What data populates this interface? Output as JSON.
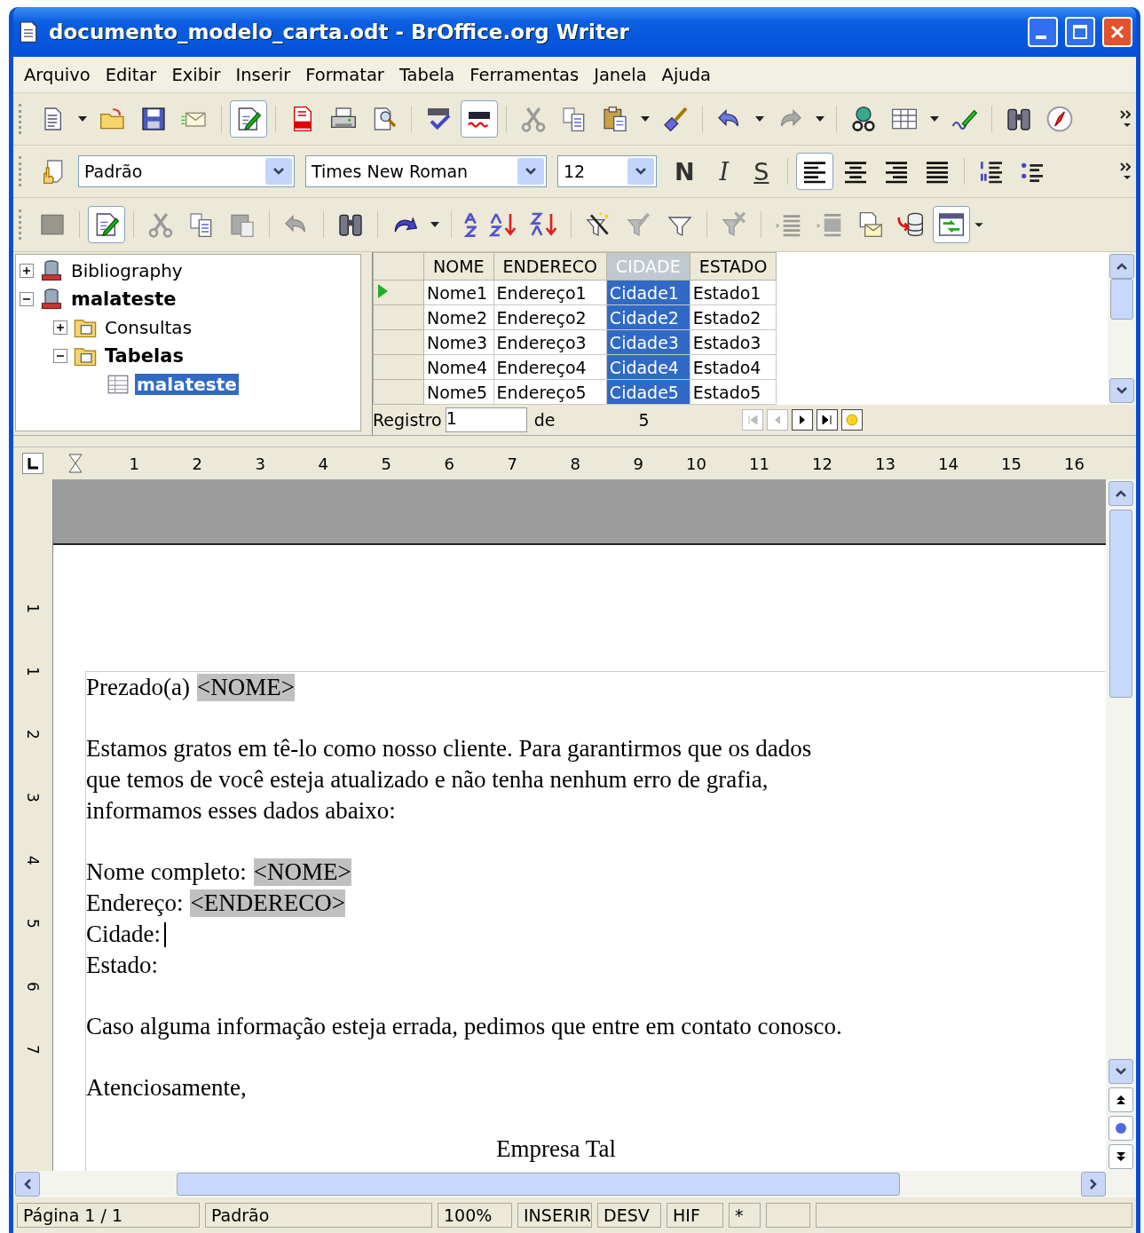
{
  "window": {
    "title": "documento_modelo_carta.odt - BrOffice.org Writer"
  },
  "menu": [
    "Arquivo",
    "Editar",
    "Exibir",
    "Inserir",
    "Formatar",
    "Tabela",
    "Ferramentas",
    "Janela",
    "Ajuda"
  ],
  "standard_toolbar": {
    "edit_mode_on": true,
    "auto_spellcheck_on": true
  },
  "formatting_toolbar": {
    "style": "Padrão",
    "font": "Times New Roman",
    "size": "12",
    "style_buttons": [
      {
        "label": "N"
      },
      {
        "label": "I"
      },
      {
        "label": "S"
      }
    ],
    "align_left_on": true
  },
  "datasource_toolbar": {
    "edit_data_on": true,
    "explorer_on": true
  },
  "datasource_tree": [
    {
      "label": "Bibliography",
      "expanded": false
    },
    {
      "label": "malateste",
      "expanded": true,
      "children": [
        {
          "label": "Consultas",
          "expanded": false
        },
        {
          "label": "Tabelas",
          "expanded": true,
          "children": [
            {
              "label": "malateste",
              "selected": true
            }
          ]
        }
      ]
    }
  ],
  "data_grid": {
    "columns": [
      {
        "label": "NOME",
        "selected": false
      },
      {
        "label": "ENDERECO",
        "selected": false
      },
      {
        "label": "CIDADE",
        "selected": true
      },
      {
        "label": "ESTADO",
        "selected": false
      }
    ],
    "rows": [
      {
        "current": true,
        "cells": [
          "Nome1",
          "Endereço1",
          "Cidade1",
          "Estado1"
        ]
      },
      {
        "current": false,
        "cells": [
          "Nome2",
          "Endereço2",
          "Cidade2",
          "Estado2"
        ]
      },
      {
        "current": false,
        "cells": [
          "Nome3",
          "Endereço3",
          "Cidade3",
          "Estado3"
        ]
      },
      {
        "current": false,
        "cells": [
          "Nome4",
          "Endereço4",
          "Cidade4",
          "Estado4"
        ]
      },
      {
        "current": false,
        "cells": [
          "Nome5",
          "Endereço5",
          "Cidade5",
          "Estado5"
        ]
      }
    ],
    "navigation": {
      "label": "Registro",
      "record": "1",
      "of": "de",
      "total": "5"
    }
  },
  "ruler": {
    "horizontal": [
      "1",
      "2",
      "3",
      "4",
      "5",
      "6",
      "7",
      "8",
      "9",
      "10",
      "11",
      "12",
      "13",
      "14",
      "15",
      "16"
    ],
    "vertical": [
      "1",
      "1",
      "2",
      "3",
      "4",
      "5",
      "6",
      "7"
    ]
  },
  "document": {
    "paragraphs": [
      {
        "kind": "body",
        "lines": [
          [
            {
              "kind": "text",
              "text": "Prezado(a)"
            },
            {
              "kind": "field",
              "text": "<NOME>"
            }
          ]
        ]
      },
      {
        "kind": "body",
        "lines": [
          [
            {
              "kind": "text",
              "text": "Estamos gratos em tê-lo como nosso cliente. Para garantirmos que os dados"
            }
          ],
          [
            {
              "kind": "text",
              "text": "que temos de você esteja atualizado e não tenha nenhum erro de grafia,"
            }
          ],
          [
            {
              "kind": "text",
              "text": "informamos esses dados abaixo:"
            }
          ]
        ]
      },
      {
        "kind": "body",
        "lines": [
          [
            {
              "kind": "text",
              "text": "Nome completo:"
            },
            {
              "kind": "field",
              "text": "<NOME>"
            }
          ],
          [
            {
              "kind": "text",
              "text": "Endereço:"
            },
            {
              "kind": "field",
              "text": "<ENDERECO>"
            }
          ],
          [
            {
              "kind": "text",
              "text": "Cidade:"
            },
            {
              "kind": "cursor"
            }
          ],
          [
            {
              "kind": "text",
              "text": "Estado:"
            }
          ]
        ]
      },
      {
        "kind": "body",
        "lines": [
          [
            {
              "kind": "text",
              "text": "Caso alguma informação esteja errada, pedimos que entre em contato conosco."
            }
          ]
        ]
      },
      {
        "kind": "body",
        "lines": [
          [
            {
              "kind": "text",
              "text": "Atenciosamente,"
            }
          ]
        ]
      },
      {
        "kind": "signature",
        "lines": [
          [
            {
              "kind": "text",
              "text": "Empresa Tal"
            }
          ]
        ]
      }
    ]
  },
  "status_bar": [
    "Página 1 / 1",
    "Padrão",
    "100%",
    "INSERIR",
    "DESV",
    "HIF",
    "*"
  ]
}
